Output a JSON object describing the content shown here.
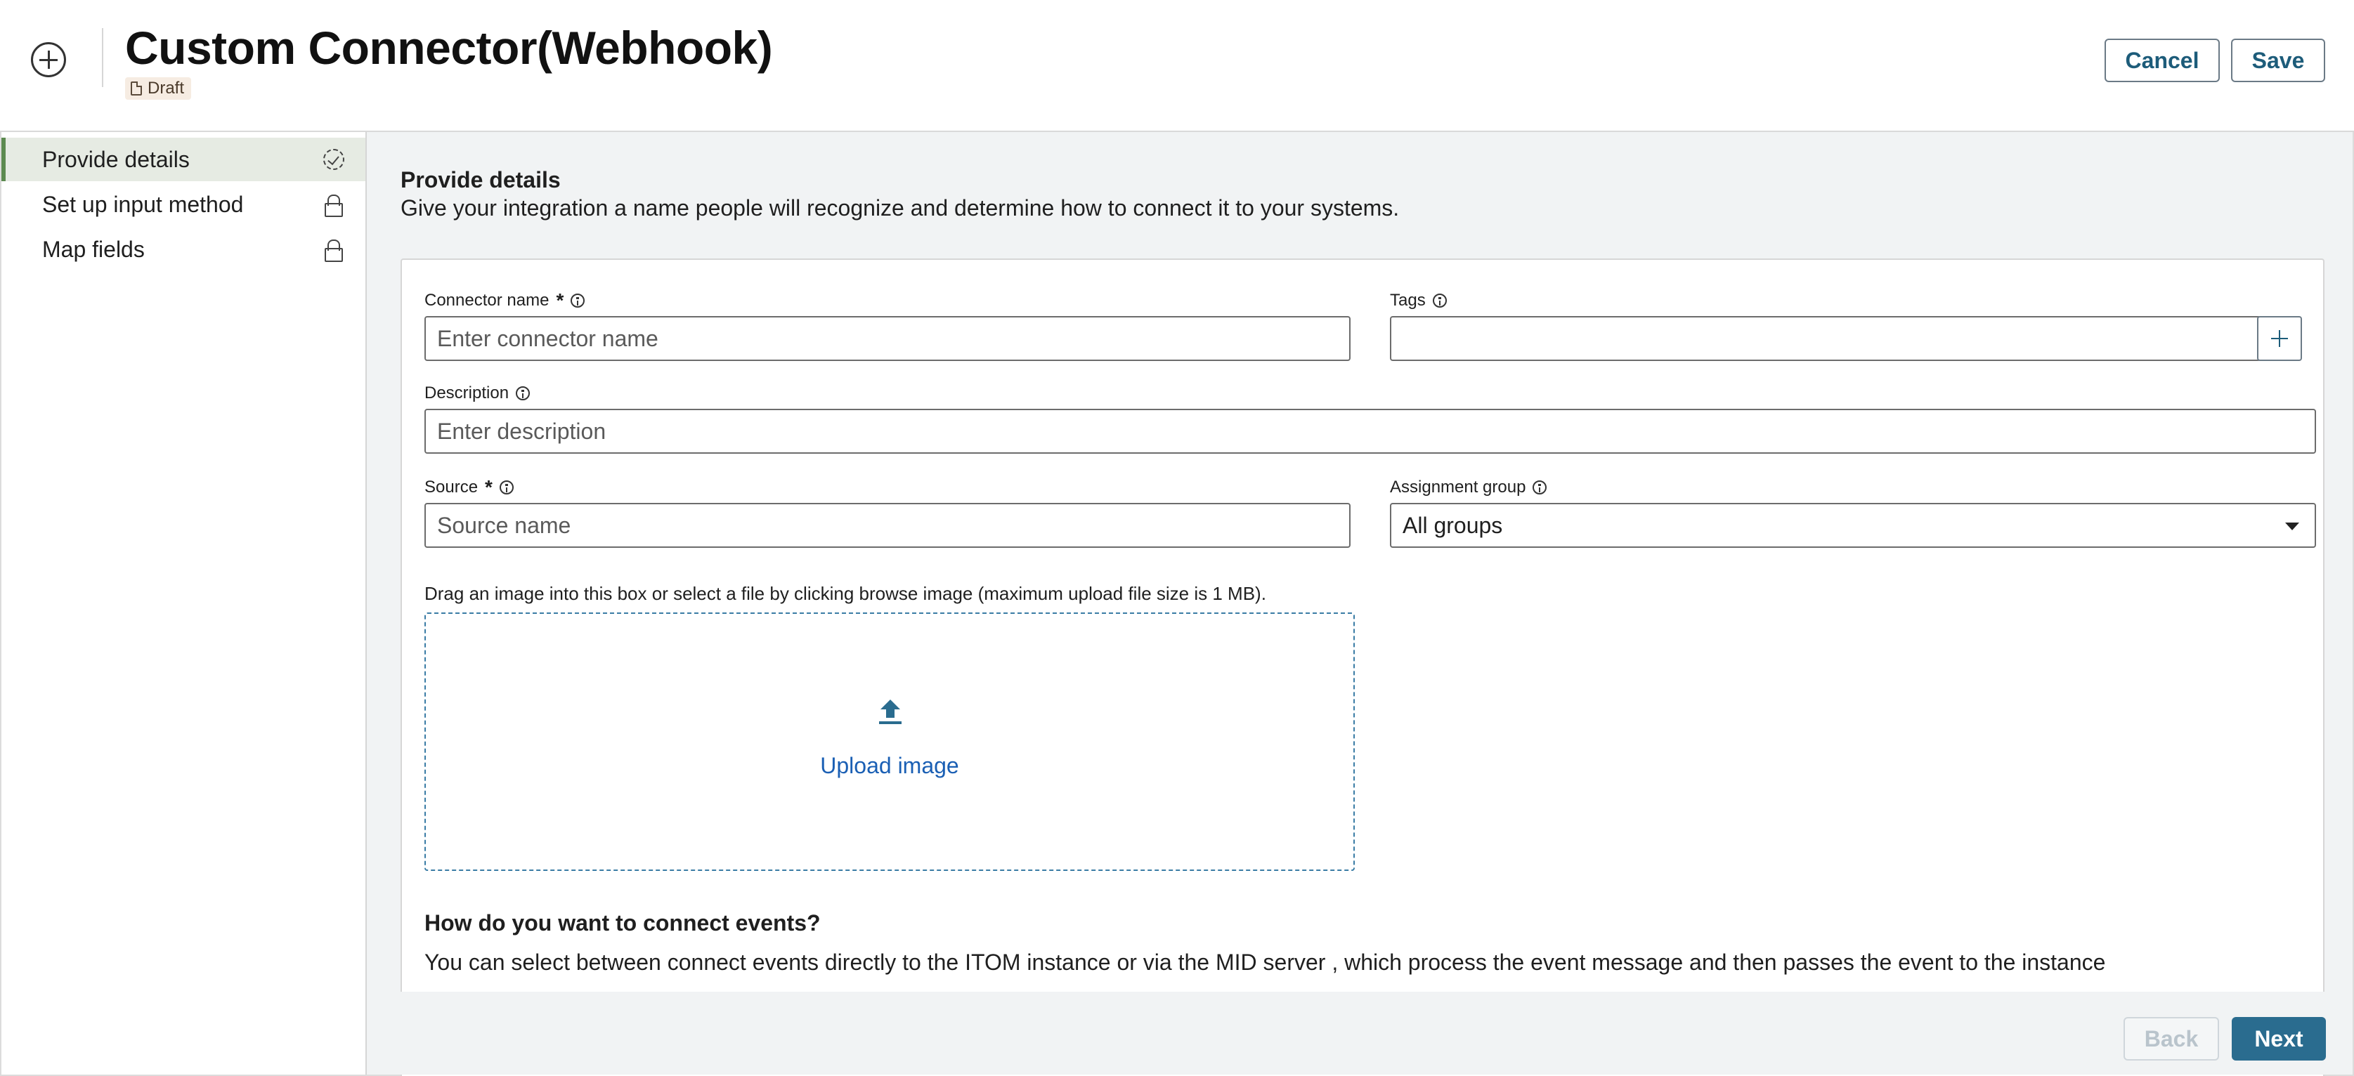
{
  "header": {
    "title": "Custom Connector(Webhook)",
    "status_badge": "Draft",
    "add_icon": "plus-circle-icon",
    "cancel_label": "Cancel",
    "save_label": "Save"
  },
  "sidebar": {
    "items": [
      {
        "label": "Provide details",
        "icon": "dashed-check-circle-icon",
        "active": true
      },
      {
        "label": "Set up input method",
        "icon": "lock-icon",
        "active": false
      },
      {
        "label": "Map fields",
        "icon": "lock-icon",
        "active": false
      }
    ],
    "active_color": "#5c8a50"
  },
  "main": {
    "section_title": "Provide details",
    "section_subtitle": "Give your integration a name people will recognize and determine how to connect it to your systems.",
    "form": {
      "connector_name": {
        "label": "Connector name",
        "required": true,
        "placeholder": "Enter connector name",
        "value": ""
      },
      "tags": {
        "label": "Tags",
        "placeholder": "",
        "value": ""
      },
      "description": {
        "label": "Description",
        "placeholder": "Enter description",
        "value": ""
      },
      "source": {
        "label": "Source",
        "required": true,
        "placeholder": "Source name",
        "value": ""
      },
      "assignment_group": {
        "label": "Assignment group",
        "selected": "All groups"
      }
    },
    "upload": {
      "hint": "Drag an image into this box or select a file by clicking browse image (maximum upload file size is 1 MB).",
      "label": "Upload image",
      "icon": "upload-icon"
    },
    "connect": {
      "title": "How do you want to connect events?",
      "description": "You can select between connect events directly to the ITOM instance or via the MID server , which process the event message and then passes the event to the instance"
    }
  },
  "footer": {
    "back_label": "Back",
    "next_label": "Next"
  },
  "colors": {
    "primary": "#2a6c8f",
    "link": "#1a5fb4",
    "badge_bg": "#f6ece2"
  }
}
